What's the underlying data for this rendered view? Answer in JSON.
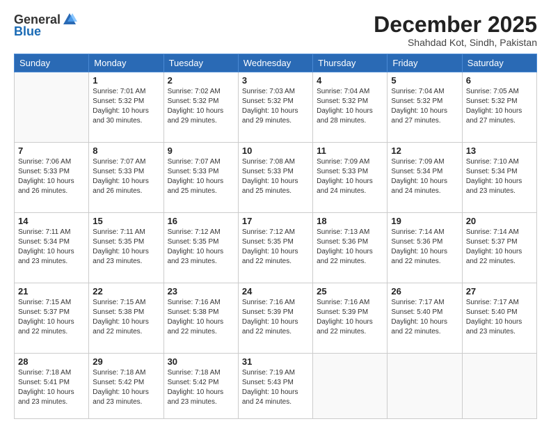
{
  "logo": {
    "general": "General",
    "blue": "Blue"
  },
  "title": "December 2025",
  "location": "Shahdad Kot, Sindh, Pakistan",
  "days_of_week": [
    "Sunday",
    "Monday",
    "Tuesday",
    "Wednesday",
    "Thursday",
    "Friday",
    "Saturday"
  ],
  "weeks": [
    [
      {
        "day": "",
        "info": ""
      },
      {
        "day": "1",
        "info": "Sunrise: 7:01 AM\nSunset: 5:32 PM\nDaylight: 10 hours\nand 30 minutes."
      },
      {
        "day": "2",
        "info": "Sunrise: 7:02 AM\nSunset: 5:32 PM\nDaylight: 10 hours\nand 29 minutes."
      },
      {
        "day": "3",
        "info": "Sunrise: 7:03 AM\nSunset: 5:32 PM\nDaylight: 10 hours\nand 29 minutes."
      },
      {
        "day": "4",
        "info": "Sunrise: 7:04 AM\nSunset: 5:32 PM\nDaylight: 10 hours\nand 28 minutes."
      },
      {
        "day": "5",
        "info": "Sunrise: 7:04 AM\nSunset: 5:32 PM\nDaylight: 10 hours\nand 27 minutes."
      },
      {
        "day": "6",
        "info": "Sunrise: 7:05 AM\nSunset: 5:32 PM\nDaylight: 10 hours\nand 27 minutes."
      }
    ],
    [
      {
        "day": "7",
        "info": "Sunrise: 7:06 AM\nSunset: 5:33 PM\nDaylight: 10 hours\nand 26 minutes."
      },
      {
        "day": "8",
        "info": "Sunrise: 7:07 AM\nSunset: 5:33 PM\nDaylight: 10 hours\nand 26 minutes."
      },
      {
        "day": "9",
        "info": "Sunrise: 7:07 AM\nSunset: 5:33 PM\nDaylight: 10 hours\nand 25 minutes."
      },
      {
        "day": "10",
        "info": "Sunrise: 7:08 AM\nSunset: 5:33 PM\nDaylight: 10 hours\nand 25 minutes."
      },
      {
        "day": "11",
        "info": "Sunrise: 7:09 AM\nSunset: 5:33 PM\nDaylight: 10 hours\nand 24 minutes."
      },
      {
        "day": "12",
        "info": "Sunrise: 7:09 AM\nSunset: 5:34 PM\nDaylight: 10 hours\nand 24 minutes."
      },
      {
        "day": "13",
        "info": "Sunrise: 7:10 AM\nSunset: 5:34 PM\nDaylight: 10 hours\nand 23 minutes."
      }
    ],
    [
      {
        "day": "14",
        "info": "Sunrise: 7:11 AM\nSunset: 5:34 PM\nDaylight: 10 hours\nand 23 minutes."
      },
      {
        "day": "15",
        "info": "Sunrise: 7:11 AM\nSunset: 5:35 PM\nDaylight: 10 hours\nand 23 minutes."
      },
      {
        "day": "16",
        "info": "Sunrise: 7:12 AM\nSunset: 5:35 PM\nDaylight: 10 hours\nand 23 minutes."
      },
      {
        "day": "17",
        "info": "Sunrise: 7:12 AM\nSunset: 5:35 PM\nDaylight: 10 hours\nand 22 minutes."
      },
      {
        "day": "18",
        "info": "Sunrise: 7:13 AM\nSunset: 5:36 PM\nDaylight: 10 hours\nand 22 minutes."
      },
      {
        "day": "19",
        "info": "Sunrise: 7:14 AM\nSunset: 5:36 PM\nDaylight: 10 hours\nand 22 minutes."
      },
      {
        "day": "20",
        "info": "Sunrise: 7:14 AM\nSunset: 5:37 PM\nDaylight: 10 hours\nand 22 minutes."
      }
    ],
    [
      {
        "day": "21",
        "info": "Sunrise: 7:15 AM\nSunset: 5:37 PM\nDaylight: 10 hours\nand 22 minutes."
      },
      {
        "day": "22",
        "info": "Sunrise: 7:15 AM\nSunset: 5:38 PM\nDaylight: 10 hours\nand 22 minutes."
      },
      {
        "day": "23",
        "info": "Sunrise: 7:16 AM\nSunset: 5:38 PM\nDaylight: 10 hours\nand 22 minutes."
      },
      {
        "day": "24",
        "info": "Sunrise: 7:16 AM\nSunset: 5:39 PM\nDaylight: 10 hours\nand 22 minutes."
      },
      {
        "day": "25",
        "info": "Sunrise: 7:16 AM\nSunset: 5:39 PM\nDaylight: 10 hours\nand 22 minutes."
      },
      {
        "day": "26",
        "info": "Sunrise: 7:17 AM\nSunset: 5:40 PM\nDaylight: 10 hours\nand 22 minutes."
      },
      {
        "day": "27",
        "info": "Sunrise: 7:17 AM\nSunset: 5:40 PM\nDaylight: 10 hours\nand 23 minutes."
      }
    ],
    [
      {
        "day": "28",
        "info": "Sunrise: 7:18 AM\nSunset: 5:41 PM\nDaylight: 10 hours\nand 23 minutes."
      },
      {
        "day": "29",
        "info": "Sunrise: 7:18 AM\nSunset: 5:42 PM\nDaylight: 10 hours\nand 23 minutes."
      },
      {
        "day": "30",
        "info": "Sunrise: 7:18 AM\nSunset: 5:42 PM\nDaylight: 10 hours\nand 23 minutes."
      },
      {
        "day": "31",
        "info": "Sunrise: 7:19 AM\nSunset: 5:43 PM\nDaylight: 10 hours\nand 24 minutes."
      },
      {
        "day": "",
        "info": ""
      },
      {
        "day": "",
        "info": ""
      },
      {
        "day": "",
        "info": ""
      }
    ]
  ]
}
